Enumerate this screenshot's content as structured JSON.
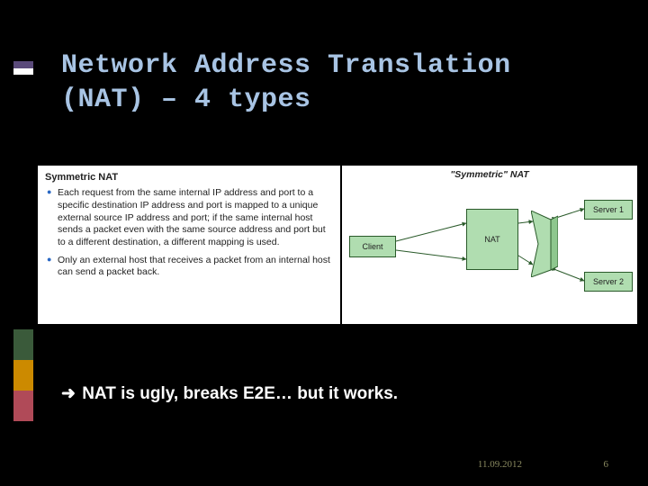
{
  "title_line1": "Network Address Translation",
  "title_line2": "(NAT) – 4 types",
  "panel": {
    "heading": "Symmetric NAT",
    "bullets": [
      "Each request from the same internal IP address and port to a specific destination IP address and port is mapped to a unique external source IP address and port; if the same internal host sends a packet even with the same source address and port but to a different destination, a different mapping is used.",
      "Only an external host that receives a packet from an internal host can send a packet back."
    ]
  },
  "diagram": {
    "title": "\"Symmetric\" NAT",
    "client": "Client",
    "nat": "NAT",
    "server1": "Server 1",
    "server2": "Server 2"
  },
  "conclusion": "NAT is ugly, breaks E2E… but it works.",
  "footer_date": "11.09.2012",
  "page_number": "6",
  "colors": {
    "title": "#a8c4e4",
    "node_fill": "#b0ddb0",
    "node_stroke": "#2a5a2a"
  }
}
